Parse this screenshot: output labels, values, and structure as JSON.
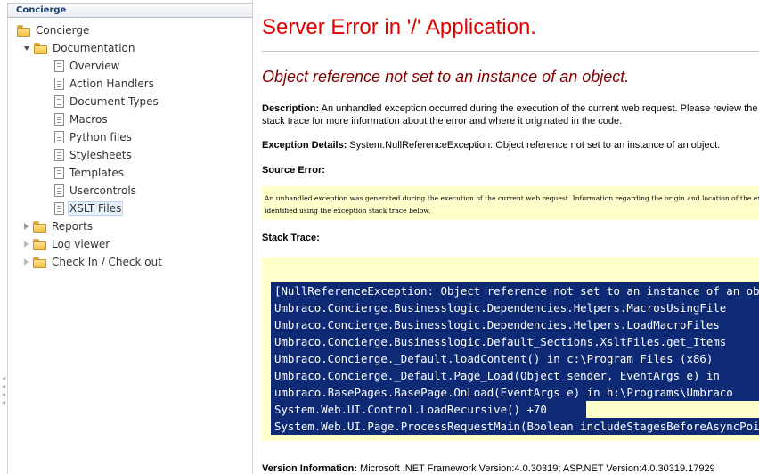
{
  "tree": {
    "header": "Concierge",
    "nodes": [
      {
        "label": "Concierge",
        "level": 0,
        "icon": "folder-icon",
        "expander": "none"
      },
      {
        "label": "Documentation",
        "level": 1,
        "icon": "folder-icon",
        "expander": "expanded"
      },
      {
        "label": "Overview",
        "level": 2,
        "icon": "document-icon",
        "expander": "none"
      },
      {
        "label": "Action Handlers",
        "level": 2,
        "icon": "document-icon",
        "expander": "none"
      },
      {
        "label": "Document Types",
        "level": 2,
        "icon": "document-icon",
        "expander": "none"
      },
      {
        "label": "Macros",
        "level": 2,
        "icon": "document-icon",
        "expander": "none"
      },
      {
        "label": "Python files",
        "level": 2,
        "icon": "document-icon",
        "expander": "none"
      },
      {
        "label": "Stylesheets",
        "level": 2,
        "icon": "document-icon",
        "expander": "none"
      },
      {
        "label": "Templates",
        "level": 2,
        "icon": "document-icon",
        "expander": "none"
      },
      {
        "label": "Usercontrols",
        "level": 2,
        "icon": "document-icon",
        "expander": "none"
      },
      {
        "label": "XSLT Files",
        "level": 2,
        "icon": "document-icon",
        "expander": "none",
        "selected": true
      },
      {
        "label": "Reports",
        "level": 1,
        "icon": "folder-icon",
        "expander": "collapsed"
      },
      {
        "label": "Log viewer",
        "level": 1,
        "icon": "folder-icon",
        "expander": "collapsed"
      },
      {
        "label": "Check In / Check out",
        "level": 1,
        "icon": "folder-icon",
        "expander": "collapsed"
      }
    ]
  },
  "error": {
    "title": "Server Error in '/' Application.",
    "message": "Object reference not set to an instance of an object.",
    "description_label": "Description:",
    "description_text": "An unhandled exception occurred during the execution of the current web request. Please review the stack trace for more information about the error and where it originated in the code.",
    "exception_label": "Exception Details:",
    "exception_text": "System.NullReferenceException: Object reference not set to an instance of an object.",
    "source_error_label": "Source Error:",
    "source_error_lines": [
      "An unhandled exception was generated during the execution of the current web request. Information regarding the origin and location of the exception can be",
      "identified using the exception stack trace below."
    ],
    "stack_trace_label": "Stack Trace:",
    "stack_lines": [
      "[NullReferenceException: Object reference not set to an instance of an object.]",
      "   Umbraco.Concierge.Businesslogic.Dependencies.Helpers.MacrosUsingFile",
      "   Umbraco.Concierge.Businesslogic.Dependencies.Helpers.LoadMacroFiles",
      "   Umbraco.Concierge.Businesslogic.Default_Sections.XsltFiles.get_Items",
      "   Umbraco.Concierge._Default.loadContent() in c:\\Program Files (x86)",
      "   Umbraco.Concierge._Default.Page_Load(Object sender, EventArgs e) in",
      "   umbraco.BasePages.BasePage.OnLoad(EventArgs e) in h:\\Programs\\Umbraco",
      "   System.Web.UI.Control.LoadRecursive() +70",
      "   System.Web.UI.Page.ProcessRequestMain(Boolean includeStagesBeforeAsyncPoint"
    ],
    "version_label": "Version Information:",
    "version_text": "Microsoft .NET Framework Version:4.0.30319; ASP.NET Version:4.0.30319.17929"
  },
  "colors": {
    "title": "#e00000",
    "message": "#800000",
    "highlight_bg": "#0e2a75",
    "code_bg": "#ffffcc"
  }
}
